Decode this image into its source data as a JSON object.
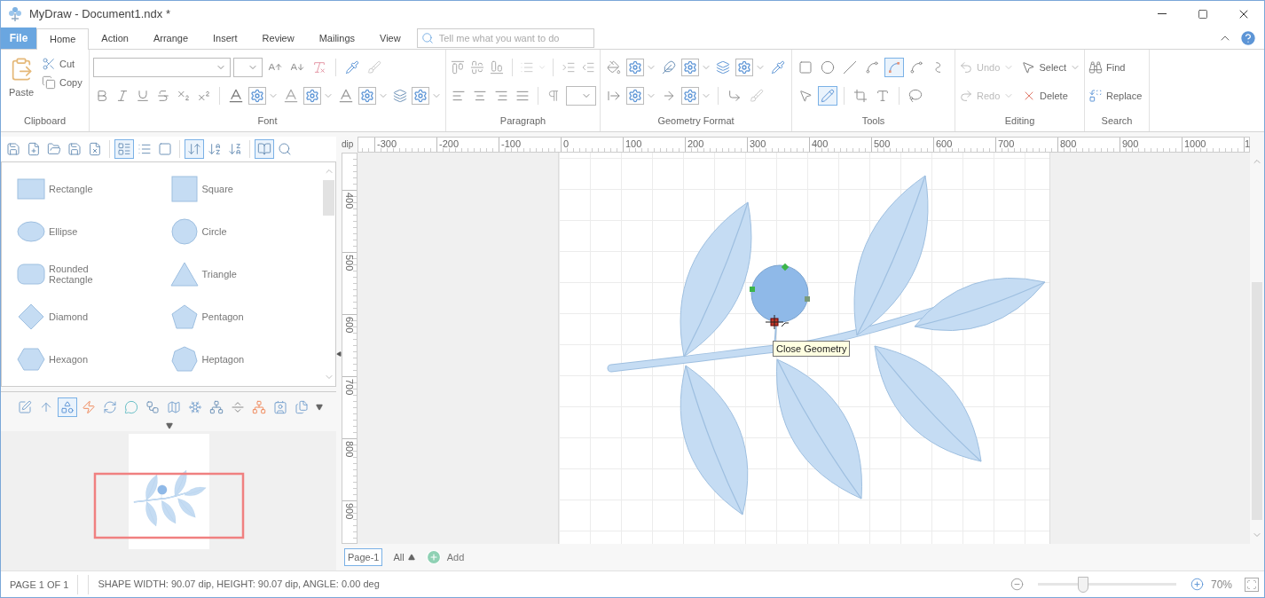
{
  "window": {
    "title": "MyDraw - Document1.ndx *"
  },
  "ribbon_tabs": [
    {
      "label": "File",
      "kind": "file",
      "selected": false
    },
    {
      "label": "Home",
      "kind": "tab",
      "selected": true
    },
    {
      "label": "Action",
      "kind": "tab",
      "selected": false
    },
    {
      "label": "Arrange",
      "kind": "tab",
      "selected": false
    },
    {
      "label": "Insert",
      "kind": "tab",
      "selected": false
    },
    {
      "label": "Review",
      "kind": "tab",
      "selected": false
    },
    {
      "label": "Mailings",
      "kind": "tab",
      "selected": false
    },
    {
      "label": "View",
      "kind": "tab",
      "selected": false
    }
  ],
  "search": {
    "placeholder": "Tell me what you want to do"
  },
  "ribbon": {
    "clipboard": {
      "label": "Clipboard",
      "paste": "Paste",
      "cut": "Cut",
      "copy": "Copy"
    },
    "font": {
      "label": "Font"
    },
    "paragraph": {
      "label": "Paragraph"
    },
    "geometry_format": {
      "label": "Geometry Format"
    },
    "tools": {
      "label": "Tools",
      "items": [
        {
          "selected": false
        },
        {
          "selected": false
        },
        {
          "selected": false
        },
        {
          "selected": false
        },
        {
          "selected": true
        },
        {
          "selected": false
        },
        {
          "selected": false
        },
        {
          "selected": false
        },
        {
          "selected": true
        },
        {
          "selected": false
        },
        {
          "selected": false
        },
        {
          "selected": false
        }
      ]
    },
    "editing": {
      "label": "Editing",
      "undo": {
        "label": "Undo",
        "disabled": true
      },
      "redo": {
        "label": "Redo",
        "disabled": true
      },
      "select": "Select",
      "delete": "Delete"
    },
    "search_group": {
      "label": "Search",
      "find": "Find",
      "replace": "Replace"
    }
  },
  "library_toolbar": [
    {
      "selected": false
    },
    {
      "selected": false
    },
    {
      "selected": false
    },
    {
      "selected": false
    },
    {
      "selected": false
    },
    {
      "selected": true
    },
    {
      "selected": false
    },
    {
      "selected": false
    },
    {
      "selected": true
    },
    {
      "selected": false
    },
    {
      "selected": false
    },
    {
      "selected": true
    },
    {
      "selected": false
    }
  ],
  "shapes": [
    {
      "name": "Rectangle",
      "kind": "rectangle"
    },
    {
      "name": "Square",
      "kind": "square"
    },
    {
      "name": "Ellipse",
      "kind": "ellipse"
    },
    {
      "name": "Circle",
      "kind": "circle"
    },
    {
      "name": "Rounded Rectangle",
      "kind": "rounded"
    },
    {
      "name": "Triangle",
      "kind": "triangle"
    },
    {
      "name": "Diamond",
      "kind": "diamond"
    },
    {
      "name": "Pentagon",
      "kind": "pentagon"
    },
    {
      "name": "Hexagon",
      "kind": "hexagon"
    },
    {
      "name": "Heptagon",
      "kind": "heptagon"
    }
  ],
  "category_toolbar": [
    {
      "selected": false
    },
    {
      "selected": false
    },
    {
      "selected": true
    },
    {
      "selected": false
    },
    {
      "selected": false
    },
    {
      "selected": false
    },
    {
      "selected": false
    },
    {
      "selected": false
    },
    {
      "selected": false
    },
    {
      "selected": false
    },
    {
      "selected": false
    },
    {
      "selected": false
    },
    {
      "selected": false
    },
    {
      "selected": false
    }
  ],
  "ruler": {
    "unit": "dip",
    "horizontal": [
      "-300",
      "-200",
      "-100",
      "0",
      "100",
      "200",
      "300",
      "400",
      "500",
      "600",
      "700",
      "800",
      "900",
      "1000",
      "1"
    ],
    "vertical": [
      "400",
      "500",
      "600",
      "700",
      "800",
      "900"
    ]
  },
  "canvas": {
    "tooltip": "Close Geometry"
  },
  "page_tabs": [
    {
      "label": "Page-1",
      "selected": true
    }
  ],
  "page_filter": "All",
  "add_page": "Add",
  "status_bar": {
    "page": "PAGE 1 OF 1",
    "shape_info": "SHAPE WIDTH: 90.07 dip, HEIGHT: 90.07 dip, ANGLE: 0.00 deg",
    "zoom": {
      "level": 0.33,
      "reading": "70%"
    }
  }
}
